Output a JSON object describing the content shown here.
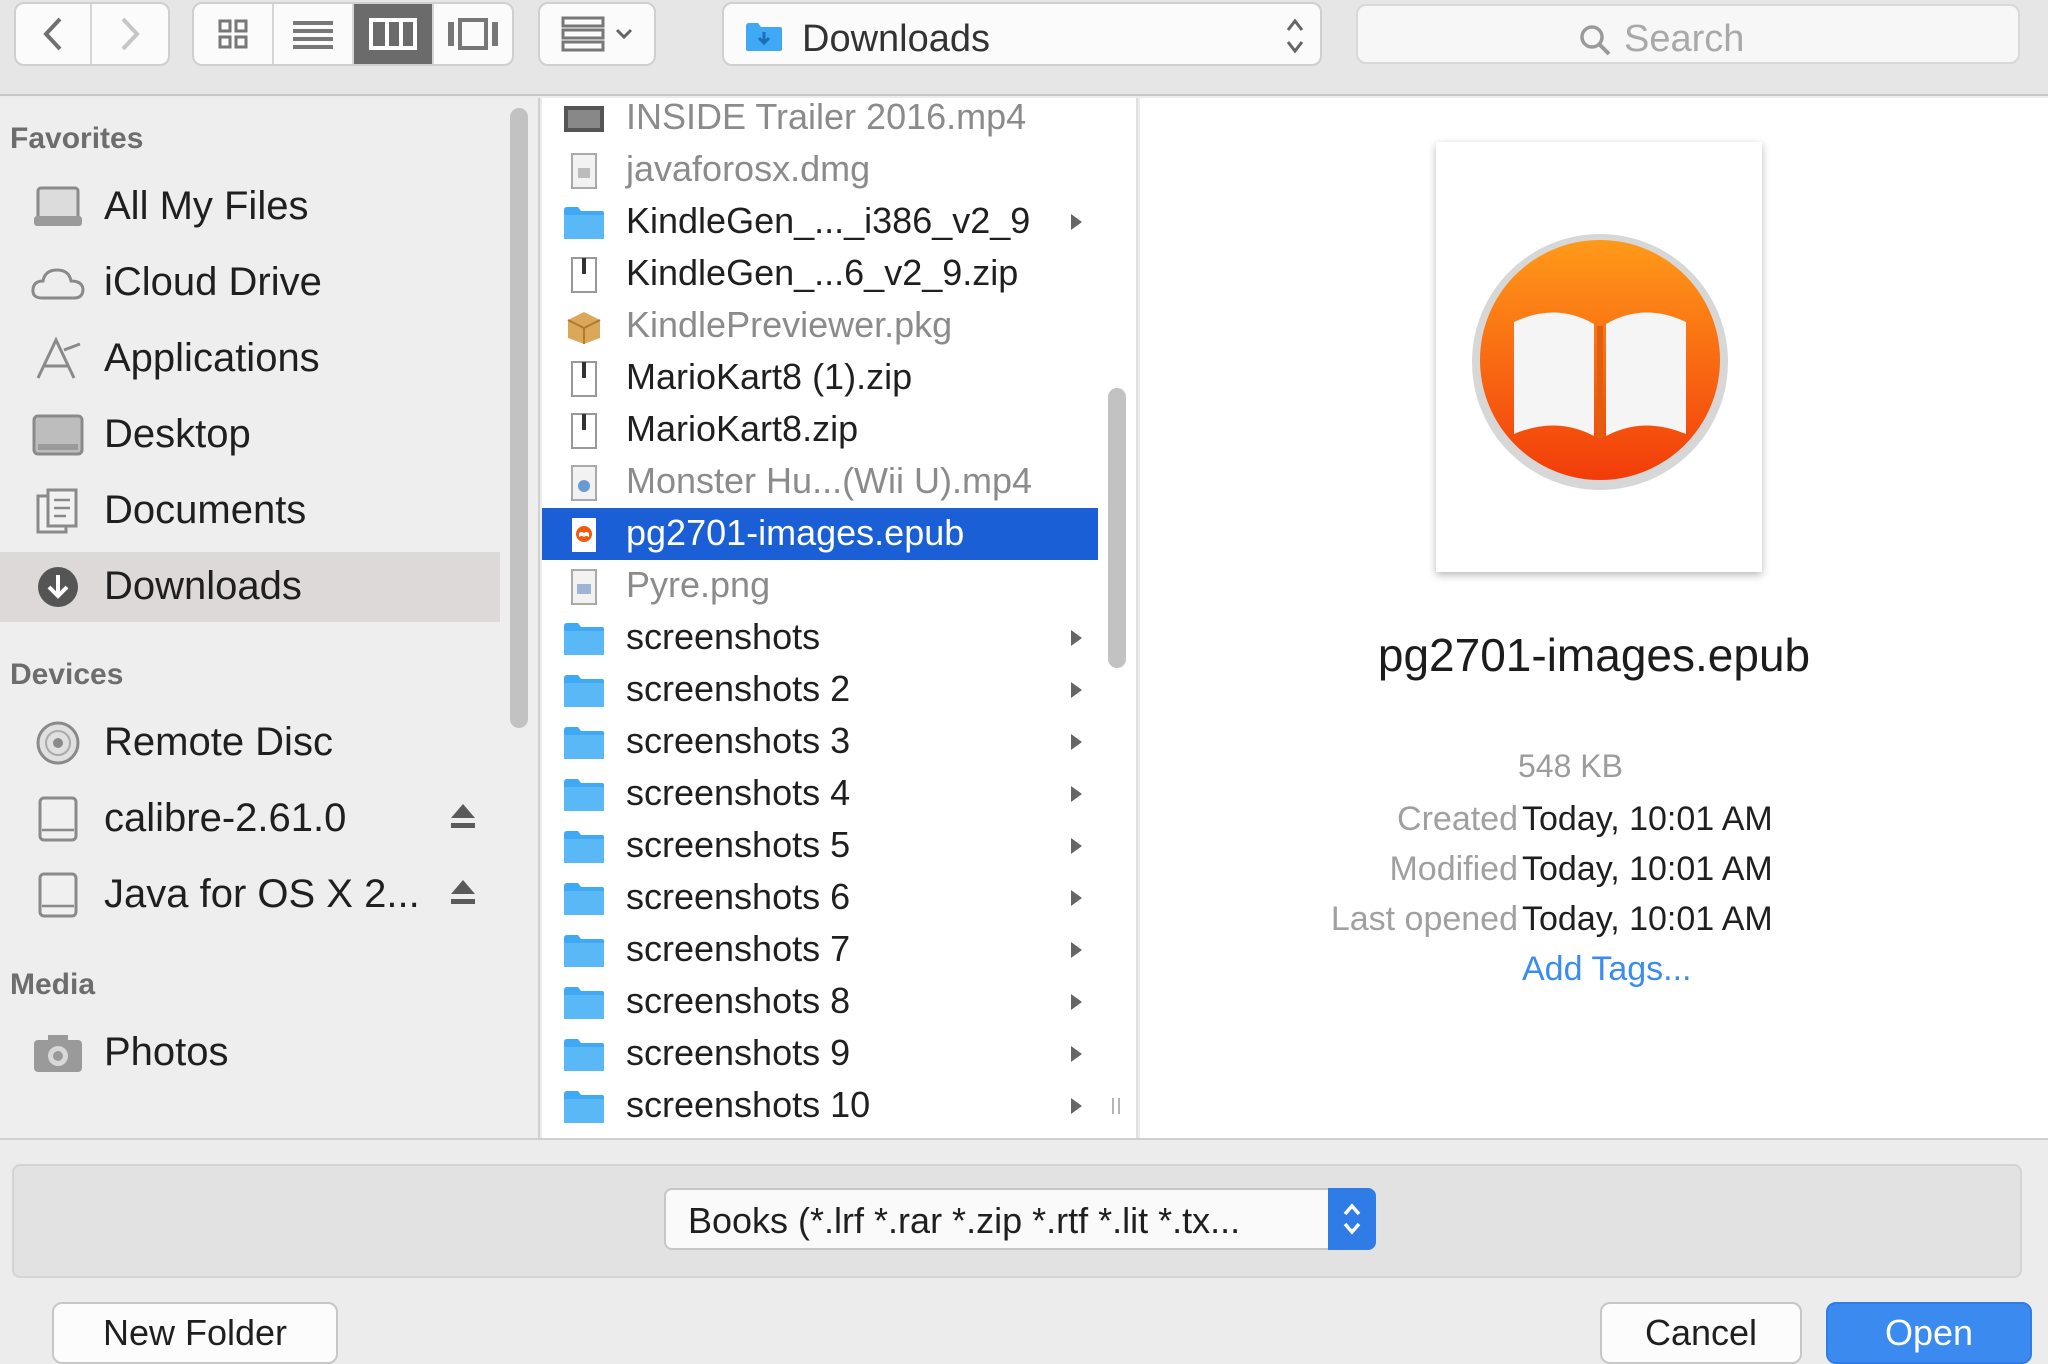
{
  "toolbar": {
    "path_label": "Downloads",
    "search_placeholder": "Search"
  },
  "sidebar": {
    "favorites_heading": "Favorites",
    "favorites": [
      {
        "label": "All My Files",
        "icon": "all-my-files-icon"
      },
      {
        "label": "iCloud Drive",
        "icon": "cloud-icon"
      },
      {
        "label": "Applications",
        "icon": "applications-icon"
      },
      {
        "label": "Desktop",
        "icon": "desktop-icon"
      },
      {
        "label": "Documents",
        "icon": "documents-icon"
      },
      {
        "label": "Downloads",
        "icon": "downloads-icon",
        "selected": true
      }
    ],
    "devices_heading": "Devices",
    "devices": [
      {
        "label": "Remote Disc",
        "icon": "disc-icon"
      },
      {
        "label": "calibre-2.61.0",
        "icon": "drive-icon",
        "eject": true
      },
      {
        "label": "Java for OS X 2...",
        "icon": "drive-icon",
        "eject": true
      }
    ],
    "media_heading": "Media",
    "media": [
      {
        "label": "Photos",
        "icon": "camera-icon"
      }
    ]
  },
  "files": [
    {
      "label": "INSIDE Trailer 2016.mp4",
      "icon": "video-file-icon",
      "dim": true
    },
    {
      "label": "javaforosx.dmg",
      "icon": "disk-image-icon",
      "dim": true
    },
    {
      "label": "KindleGen_..._i386_v2_9",
      "icon": "folder-icon",
      "folder": true
    },
    {
      "label": "KindleGen_...6_v2_9.zip",
      "icon": "zip-file-icon"
    },
    {
      "label": "KindlePreviewer.pkg",
      "icon": "package-icon",
      "dim": true
    },
    {
      "label": "MarioKart8 (1).zip",
      "icon": "zip-file-icon"
    },
    {
      "label": "MarioKart8.zip",
      "icon": "zip-file-icon"
    },
    {
      "label": "Monster Hu...(Wii U).mp4",
      "icon": "video-file-icon",
      "dim": true
    },
    {
      "label": "pg2701-images.epub",
      "icon": "epub-file-icon",
      "selected": true
    },
    {
      "label": "Pyre.png",
      "icon": "image-file-icon",
      "dim": true
    },
    {
      "label": "screenshots",
      "icon": "folder-icon",
      "folder": true
    },
    {
      "label": "screenshots 2",
      "icon": "folder-icon",
      "folder": true
    },
    {
      "label": "screenshots 3",
      "icon": "folder-icon",
      "folder": true
    },
    {
      "label": "screenshots 4",
      "icon": "folder-icon",
      "folder": true
    },
    {
      "label": "screenshots 5",
      "icon": "folder-icon",
      "folder": true
    },
    {
      "label": "screenshots 6",
      "icon": "folder-icon",
      "folder": true
    },
    {
      "label": "screenshots 7",
      "icon": "folder-icon",
      "folder": true
    },
    {
      "label": "screenshots 8",
      "icon": "folder-icon",
      "folder": true
    },
    {
      "label": "screenshots 9",
      "icon": "folder-icon",
      "folder": true
    },
    {
      "label": "screenshots 10",
      "icon": "folder-icon",
      "folder": true
    }
  ],
  "preview": {
    "name": "pg2701-images.epub",
    "size": "548 KB",
    "created_label": "Created",
    "created_value": "Today, 10:01 AM",
    "modified_label": "Modified",
    "modified_value": "Today, 10:01 AM",
    "opened_label": "Last opened",
    "opened_value": "Today, 10:01 AM",
    "add_tags": "Add Tags..."
  },
  "bottom": {
    "filter_label": "Books (*.lrf *.rar *.zip *.rtf *.lit *.tx...",
    "new_folder": "New Folder",
    "cancel": "Cancel",
    "open": "Open"
  },
  "colors": {
    "selection": "#1a5fd5",
    "folder": "#3fa9f5",
    "link": "#3a8cf0",
    "primary_button": "#3a8af0"
  }
}
